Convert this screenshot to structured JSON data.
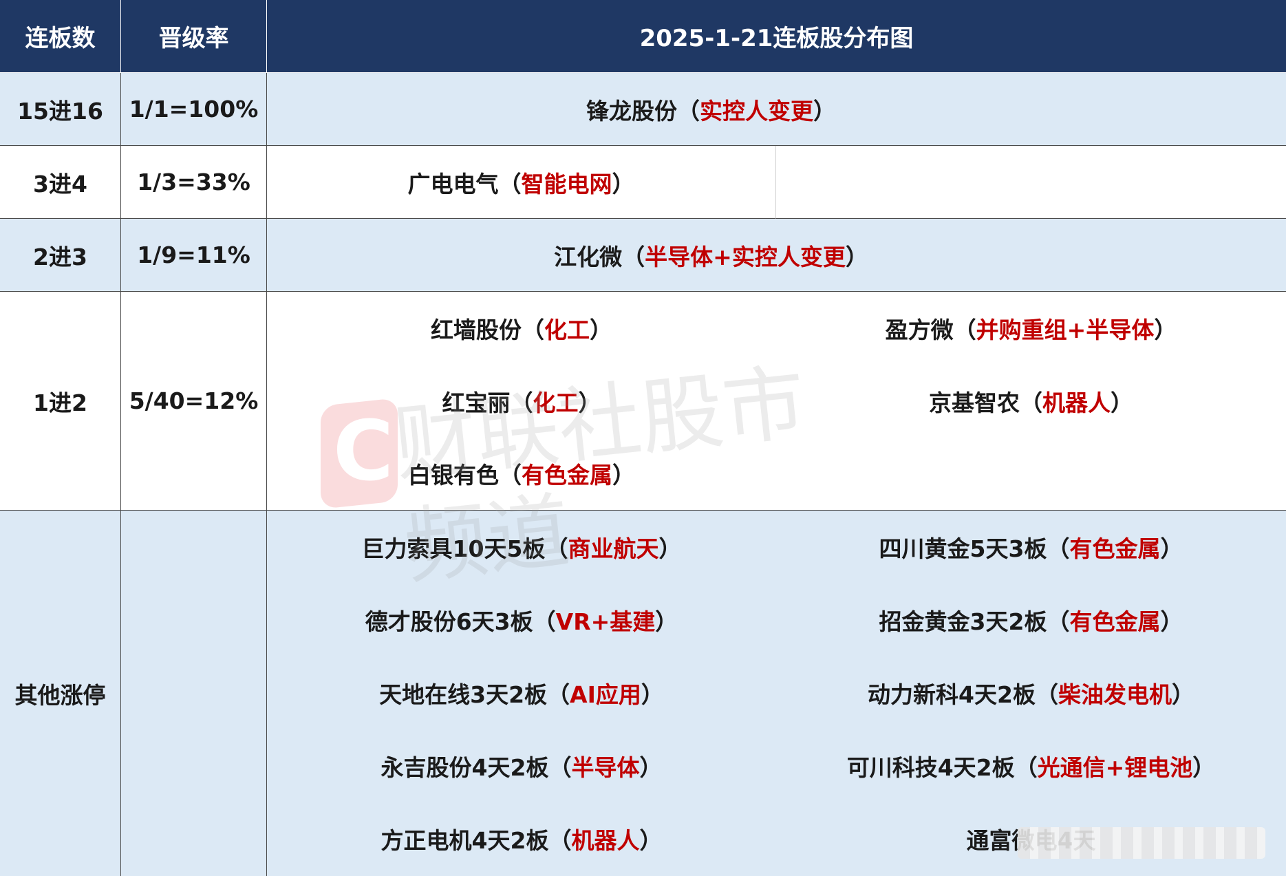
{
  "header": {
    "col1": "连板数",
    "col2": "晋级率",
    "title": "2025-1-21连板股分布图"
  },
  "rows": {
    "r15": {
      "level": "15进16",
      "rate": "1/1=100%",
      "stocks": [
        {
          "name": "锋龙股份",
          "tag": "实控人变更"
        }
      ]
    },
    "r3": {
      "level": "3进4",
      "rate": "1/3=33%",
      "stocks": [
        {
          "name": "广电电气",
          "tag": "智能电网"
        }
      ]
    },
    "r2": {
      "level": "2进3",
      "rate": "1/9=11%",
      "stocks": [
        {
          "name": "江化微",
          "tag": "半导体+实控人变更"
        }
      ]
    },
    "r1": {
      "level": "1进2",
      "rate": "5/40=12%",
      "left": [
        {
          "name": "红墙股份",
          "tag": "化工"
        },
        {
          "name": "红宝丽",
          "tag": "化工"
        },
        {
          "name": "白银有色",
          "tag": "有色金属"
        }
      ],
      "right": [
        {
          "name": "盈方微",
          "tag": "并购重组+半导体"
        },
        {
          "name": "京基智农",
          "tag": "机器人"
        }
      ]
    },
    "other": {
      "level": "其他涨停",
      "left": [
        {
          "name": "巨力索具10天5板",
          "tag": "商业航天"
        },
        {
          "name": "德才股份6天3板",
          "tag": "VR+基建"
        },
        {
          "name": "天地在线3天2板",
          "tag": "AI应用"
        },
        {
          "name": "永吉股份4天2板",
          "tag": "半导体"
        },
        {
          "name": "方正电机4天2板",
          "tag": "机器人"
        }
      ],
      "right": [
        {
          "name": "四川黄金5天3板",
          "tag": "有色金属"
        },
        {
          "name": "招金黄金3天2板",
          "tag": "有色金属"
        },
        {
          "name": "动力新科4天2板",
          "tag": "柴油发电机"
        },
        {
          "name": "可川科技4天2板",
          "tag": "光通信+锂电池"
        },
        {
          "name": "通富微电4天"
        }
      ]
    }
  },
  "paren_open": "（",
  "paren_close": "）",
  "watermark": {
    "logo_letter": "C",
    "text": "财联社股市频道"
  },
  "colors": {
    "header_bg": "#1f3864",
    "shade_bg": "#dce9f5",
    "tag_red": "#c00000"
  }
}
